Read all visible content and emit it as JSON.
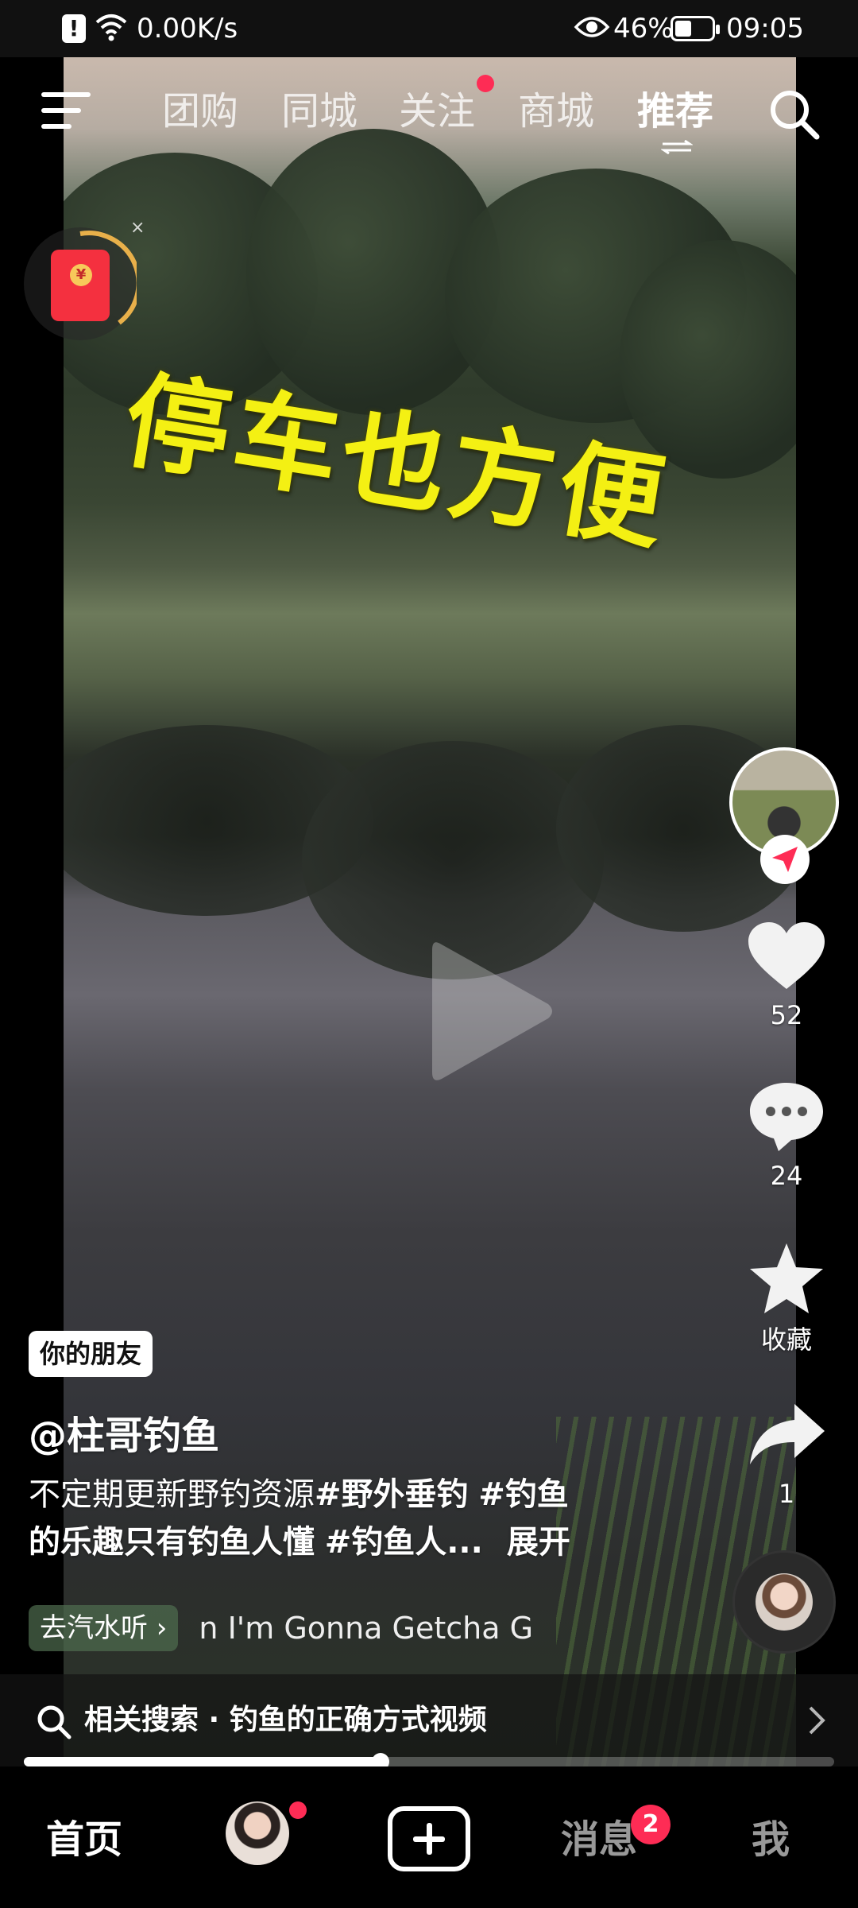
{
  "status_bar": {
    "alert_glyph": "!",
    "speed": "0.00K/s",
    "battery": "46%",
    "battery_level": 0.46,
    "time": "09:05"
  },
  "top_nav": {
    "tabs": [
      {
        "label": "团购",
        "active": false
      },
      {
        "label": "同城",
        "active": false
      },
      {
        "label": "关注",
        "active": false,
        "has_dot": true
      },
      {
        "label": "商城",
        "active": false
      },
      {
        "label": "推荐",
        "active": true
      }
    ]
  },
  "red_packet": {
    "coin": "¥",
    "close": "×"
  },
  "video": {
    "caption": "停车也方便"
  },
  "right_rail": {
    "likes": "52",
    "comments": "24",
    "favorite_label": "收藏",
    "shares": "1"
  },
  "post": {
    "friend_tag": "你的朋友",
    "author": "@柱哥钓鱼",
    "desc_plain": "不定期更新野钓资源",
    "desc_tag1": "#野外垂钓",
    "desc_tag2": "#钓鱼",
    "desc_line2_start": "的乐趣只有钓鱼人懂",
    "desc_tag3": "#钓鱼人...",
    "expand": "展开",
    "music_chip": "去汽水听 ›",
    "music_title": "n   I'm Gonna Getcha G"
  },
  "related_search": {
    "text": "相关搜索 · 钓鱼的正确方式视频"
  },
  "progress": {
    "value": 0.44
  },
  "bottom_nav": {
    "home": "首页",
    "messages": "消息",
    "messages_badge": "2",
    "me": "我"
  },
  "colors": {
    "accent": "#fe2c55",
    "caption": "#f4f013"
  }
}
